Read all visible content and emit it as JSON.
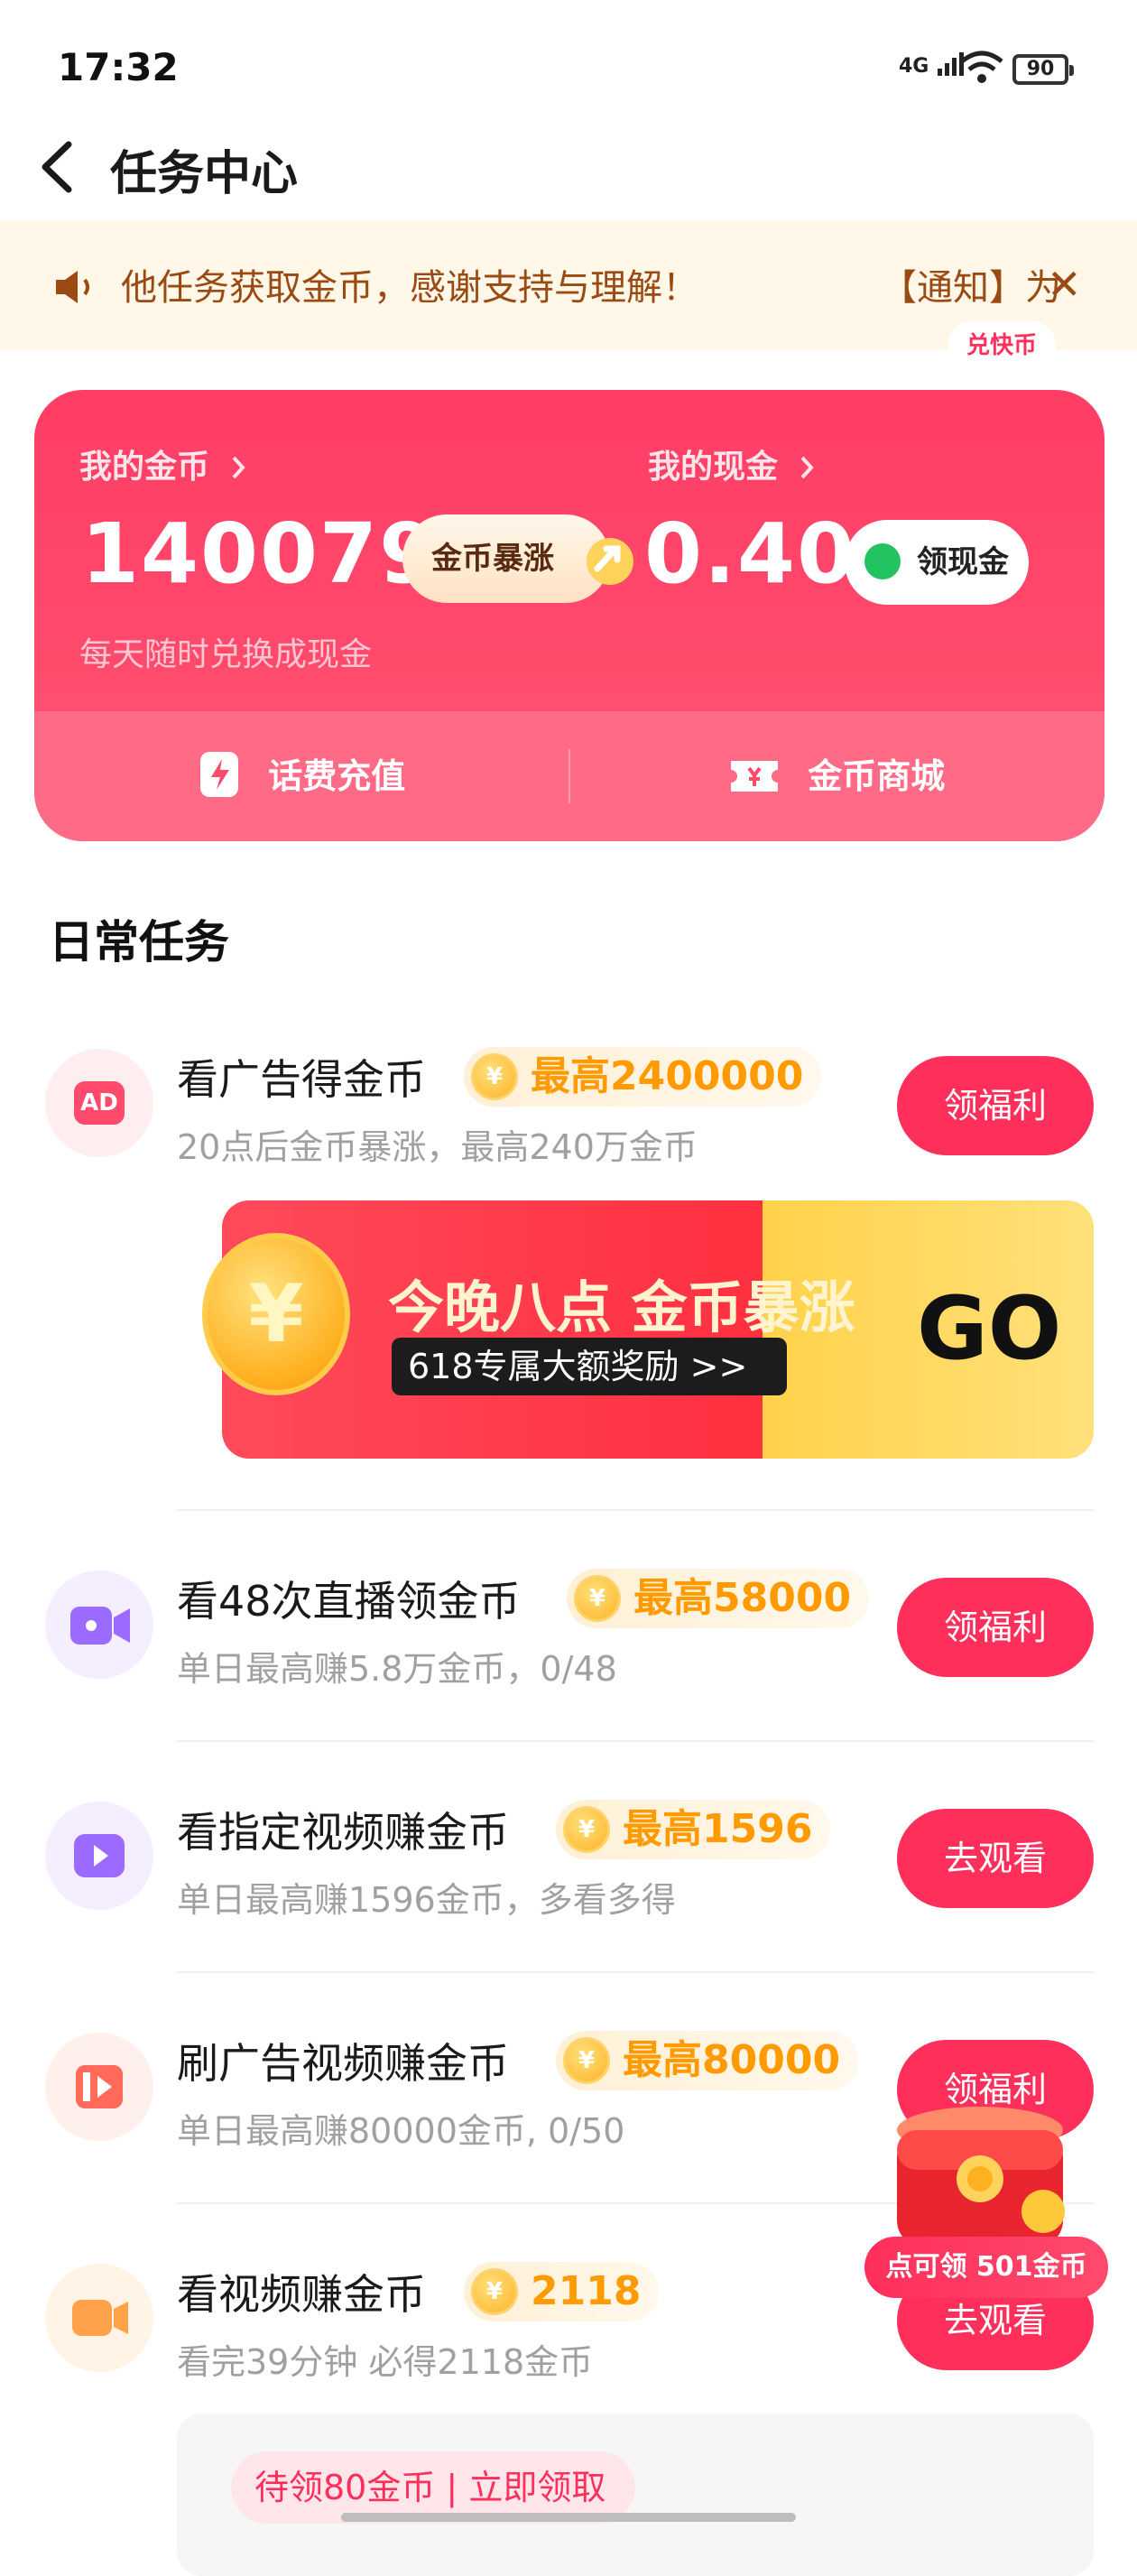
{
  "status_bar": {
    "time": "17:32",
    "signal": "4G",
    "battery": "90"
  },
  "header": {
    "title": "任务中心"
  },
  "notice": {
    "text": "他任务获取金币，感谢支持与理解！",
    "tag": "【通知】为",
    "close": "✕"
  },
  "wallet": {
    "coins_label": "我的金币",
    "coins_value": "140079",
    "boost_label": "金币暴涨",
    "cash_label": "我的现金",
    "cash_value": "0.40",
    "cashout_label": "领现金",
    "subtitle": "每天随时兑换成现金",
    "recharge_label": "话费充值",
    "mall_label": "金币商城",
    "mall_badge": "兑快币"
  },
  "section": {
    "title": "日常任务"
  },
  "tasks": [
    {
      "icon": "ad-icon",
      "title": "看广告得金币",
      "reward": "最高2400000",
      "subtitle": "20点后金币暴涨，最高240万金币",
      "button": "领福利"
    },
    {
      "icon": "live-camera-icon",
      "title": "看48次直播领金币",
      "reward": "最高58000",
      "subtitle": "单日最高赚5.8万金币，0/48",
      "button": "领福利"
    },
    {
      "icon": "play-icon",
      "title": "看指定视频赚金币",
      "reward": "最高1596",
      "subtitle": "单日最高赚1596金币，多看多得",
      "button": "去观看"
    },
    {
      "icon": "video-ad-icon",
      "title": "刷广告视频赚金币",
      "reward": "最高80000",
      "subtitle": "单日最高赚80000金币, 0/50",
      "button": "领福利"
    },
    {
      "icon": "video-icon",
      "title": "看视频赚金币",
      "reward": "2118",
      "subtitle": "看完39分钟 必得2118金币",
      "button": "去观看"
    }
  ],
  "banner": {
    "headline": "今晚八点 金币暴涨",
    "pill": "618专属大额奖励 >>",
    "go": "GO",
    "coin_glyph": "¥"
  },
  "coin_glyph": "¥",
  "bottom_card": {
    "pill": "待领80金币 | 立即领取"
  },
  "floating": {
    "badge": "点可领 501金币"
  },
  "colors": {
    "accent": "#ff2f5c",
    "card": "#ff4a6c",
    "reward": "#ff9a00",
    "notice_bg": "#fff8e8",
    "notice_text": "#9a4a12"
  }
}
